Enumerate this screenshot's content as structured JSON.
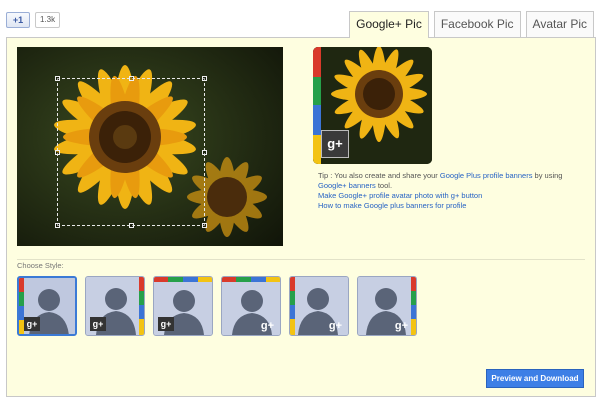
{
  "plusone": {
    "label": "+1",
    "count": "1.3k"
  },
  "tabs": [
    {
      "label": "Google+ Pic",
      "active": true
    },
    {
      "label": "Facebook Pic",
      "active": false
    },
    {
      "label": "Avatar Pic",
      "active": false
    }
  ],
  "tip": {
    "prefix": "Tip : You also create and share your ",
    "link1": "Google Plus profile banners",
    "middle": " by using ",
    "link2": "Google+ banners",
    "suffix": " tool.",
    "link3": "Make Google+ profile avatar photo with g+ button",
    "link4": "How to make Google plus banners for profile"
  },
  "choose_label": "Choose Style:",
  "badge_text": "g+",
  "preview_button": "Preview and Download",
  "colors": {
    "red": "#d93a2b",
    "green": "#26a04a",
    "blue": "#3b74d6",
    "yellow": "#f3c313",
    "button": "#3d7fe6"
  }
}
